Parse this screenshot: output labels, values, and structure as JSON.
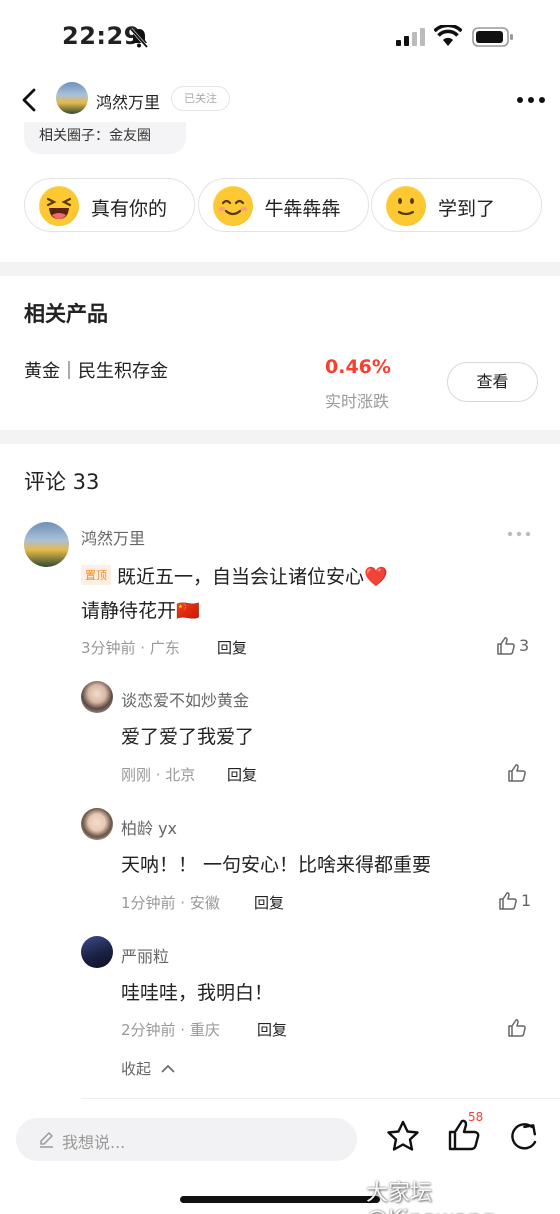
{
  "status_bar": {
    "time": "22:29"
  },
  "header": {
    "author": "鸿然万里",
    "follow_state": "已关注"
  },
  "circle_tag": "相关圈子：金友圈",
  "reactions": [
    {
      "emoji": "laughing-emoji",
      "label": "真有你的"
    },
    {
      "emoji": "smiling-emoji",
      "label": "牛犇犇犇"
    },
    {
      "emoji": "slight-smile-emoji",
      "label": "学到了"
    }
  ],
  "related_products": {
    "title": "相关产品",
    "name": "黄金｜民生积存金",
    "change": "0.46%",
    "change_label": "实时涨跌",
    "view_button": "查看",
    "accent_color": "#f5402f"
  },
  "comments": {
    "title": "评论 33",
    "main": {
      "author": "鸿然万里",
      "pin_label": "置顶",
      "line1": "既近五一，自当会让诸位安心❤️",
      "line2": "请静待花开🇨🇳",
      "meta": "3分钟前 · 广东",
      "reply": "回复",
      "likes": "3"
    },
    "replies": [
      {
        "author": "谈恋爱不如炒黄金",
        "text": "爱了爱了我爱了",
        "meta": "刚刚 · 北京",
        "reply": "回复",
        "likes": ""
      },
      {
        "author": "柏龄 yx",
        "text": "天呐！！ 一句安心！比啥来得都重要",
        "meta": "1分钟前 · 安徽",
        "reply": "回复",
        "likes": "1"
      },
      {
        "author": "严丽粒",
        "text": "哇哇哇，我明白！",
        "meta": "2分钟前 · 重庆",
        "reply": "回复",
        "likes": ""
      }
    ],
    "collapse_label": "收起"
  },
  "bottom_bar": {
    "input_placeholder": "我想说...",
    "like_badge": "58"
  },
  "watermark": "大家坛@Kinawang"
}
